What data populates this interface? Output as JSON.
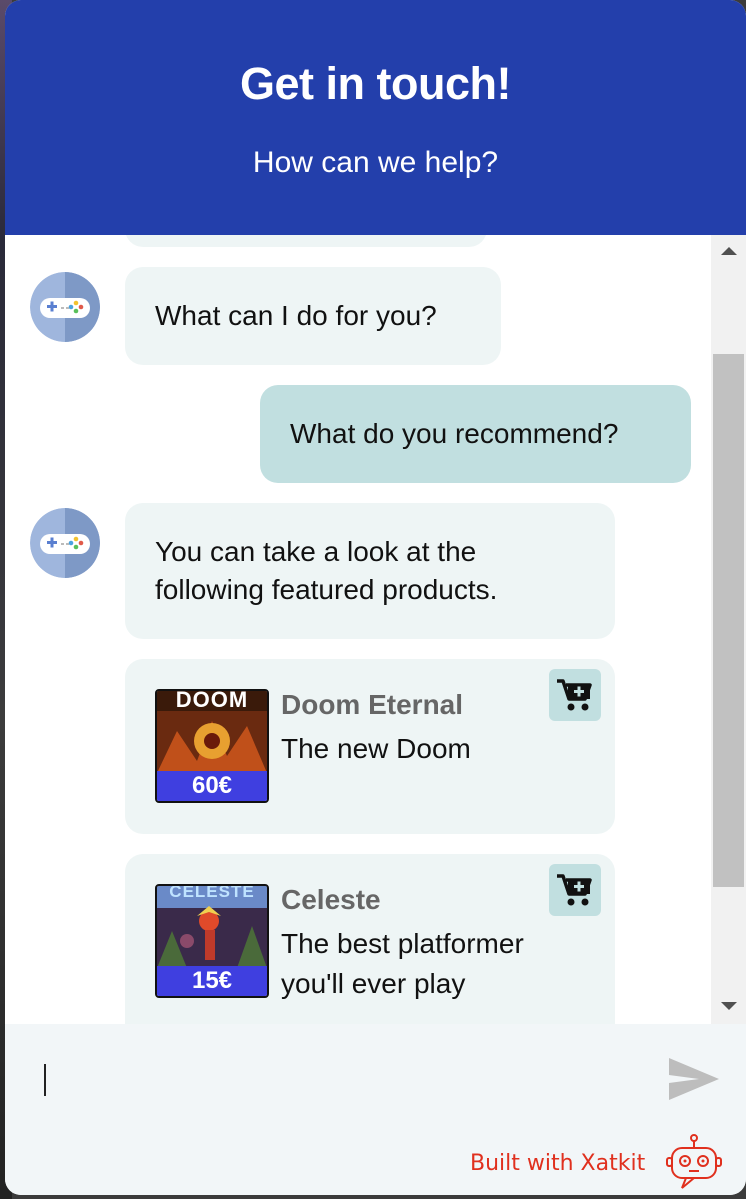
{
  "header": {
    "title": "Get in touch!",
    "subtitle": "How can we help?"
  },
  "messages": [
    {
      "sender": "bot",
      "text": "What can I do for you?"
    },
    {
      "sender": "user",
      "text": "What do you recommend?"
    },
    {
      "sender": "bot",
      "text": "You can take a look at the following featured products."
    }
  ],
  "products": [
    {
      "name": "Doom Eternal",
      "description": "The new Doom",
      "price": "60€",
      "logo": "DOOM"
    },
    {
      "name": "Celeste",
      "description": "The best platformer you'll ever play",
      "price": "15€",
      "logo": "CELESTE"
    }
  ],
  "composer": {
    "placeholder": "",
    "value": ""
  },
  "footer": {
    "built_with": "Built with Xatkit"
  },
  "icons": {
    "avatar": "gamepad-icon",
    "cart": "add-to-cart-icon",
    "send": "send-icon",
    "brand": "robot-icon"
  },
  "colors": {
    "header": "#233fab",
    "bot_bubble": "#eef5f5",
    "user_bubble": "#c1dfe0",
    "brand": "#e0301e"
  }
}
